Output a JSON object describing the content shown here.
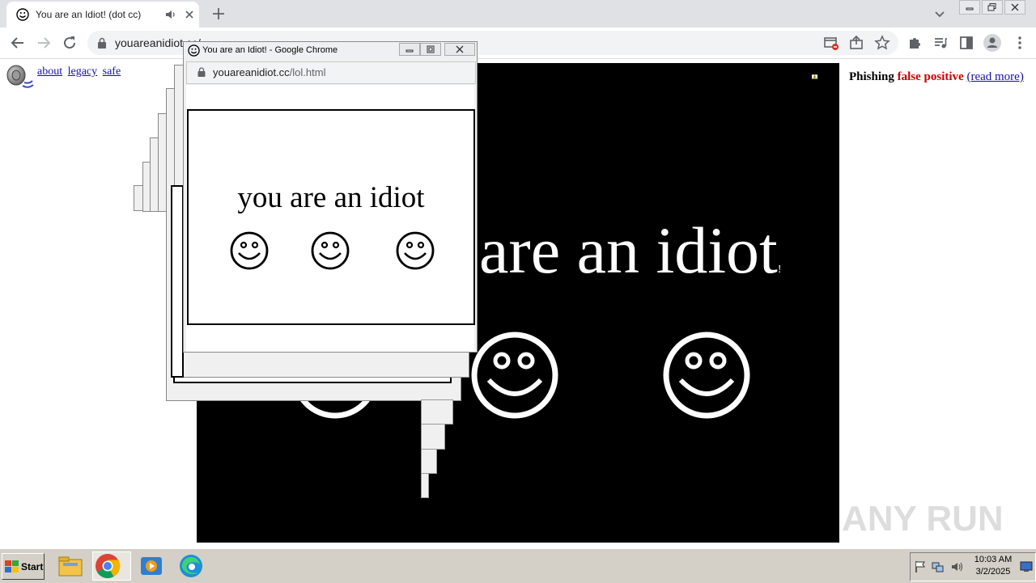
{
  "browser": {
    "tab": {
      "title": "You are an Idiot! (dot cc)"
    },
    "address": {
      "url": "youareanidiot.cc/"
    }
  },
  "page": {
    "links": [
      "about",
      "legacy",
      "safe"
    ],
    "big_text": "are an idiot",
    "big_text_suffix": "!",
    "banner": {
      "word1": "Phishing",
      "word2": "false positive",
      "link": "(read more)"
    }
  },
  "popup": {
    "window_title": "You are an Idiot! - Google Chrome",
    "url_host": "youareanidiot.cc",
    "url_path": "/lol.html",
    "text": "you are an idiot",
    "smileys": 3
  },
  "taskbar": {
    "start_label": "Start",
    "time": "10:03 AM",
    "date": "3/2/2025"
  },
  "watermark": "ANY RUN"
}
